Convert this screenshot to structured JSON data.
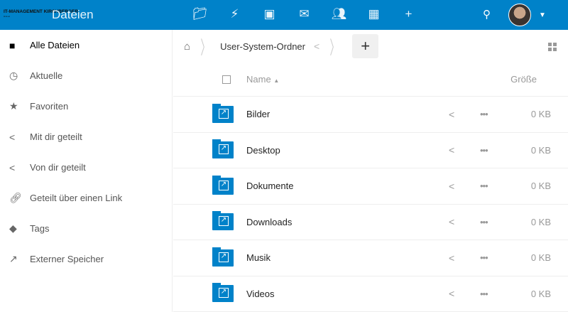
{
  "header": {
    "logo": "IT-MANAGEMENT KIRCHBERGER",
    "logo_sub": "itmk.at",
    "app_name": "Dateien",
    "apps": [
      "files-icon",
      "activity-icon",
      "gallery-icon",
      "mail-icon",
      "contacts-icon",
      "calendar-icon",
      "add-app-icon"
    ]
  },
  "sidebar": {
    "items": [
      {
        "label": "Alle Dateien",
        "icon": "folder-icon"
      },
      {
        "label": "Aktuelle",
        "icon": "clock-icon"
      },
      {
        "label": "Favoriten",
        "icon": "star-icon"
      },
      {
        "label": "Mit dir geteilt",
        "icon": "share-icon"
      },
      {
        "label": "Von dir geteilt",
        "icon": "share-icon"
      },
      {
        "label": "Geteilt über einen Link",
        "icon": "link-icon"
      },
      {
        "label": "Tags",
        "icon": "tag-icon"
      },
      {
        "label": "Externer Speicher",
        "icon": "external-icon"
      }
    ]
  },
  "breadcrumb": {
    "folder": "User-System-Ordner",
    "add": "+"
  },
  "table": {
    "name_header": "Name",
    "size_header": "Größe",
    "rows": [
      {
        "name": "Bilder",
        "size": "0 KB"
      },
      {
        "name": "Desktop",
        "size": "0 KB"
      },
      {
        "name": "Dokumente",
        "size": "0 KB"
      },
      {
        "name": "Downloads",
        "size": "0 KB"
      },
      {
        "name": "Musik",
        "size": "0 KB"
      },
      {
        "name": "Videos",
        "size": "0 KB"
      }
    ]
  },
  "colors": {
    "brand": "#0082c9"
  }
}
